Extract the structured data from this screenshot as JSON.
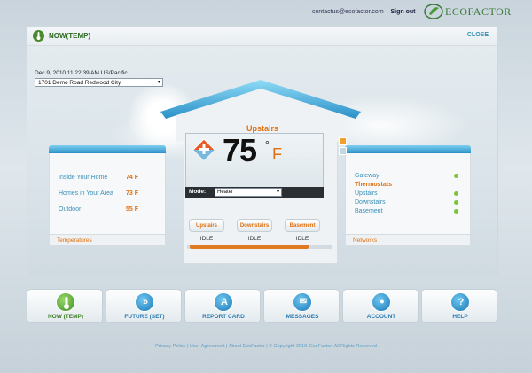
{
  "header": {
    "email": "contactus@ecofactor.com",
    "separator": "|",
    "signout": "Sign out",
    "logo_text": "ECOFACTOR"
  },
  "panel": {
    "title": "NOW(TEMP)",
    "close": "CLOSE",
    "datetime": "Dec 9, 2010 11:22:39 AM US/Pacific",
    "location": "1701 Demo Road Redwood City"
  },
  "temperatures": {
    "rows": [
      {
        "label": "Inside Your Home",
        "value": "74 F"
      },
      {
        "label": "Homes in Your Area",
        "value": "73 F"
      },
      {
        "label": "Outdoor",
        "value": "55 F"
      }
    ],
    "tab": "Temperatures"
  },
  "networks": {
    "rows": [
      {
        "label": "Gateway",
        "status": "ok"
      },
      {
        "label": "Thermostats",
        "status": "header"
      },
      {
        "label": "Upstairs",
        "status": "ok"
      },
      {
        "label": "Downstairs",
        "status": "ok"
      },
      {
        "label": "Basement",
        "status": "ok"
      }
    ],
    "tab": "Networks"
  },
  "thermostat": {
    "name": "Upstairs",
    "temp": "75",
    "degree": "°",
    "unit": "F",
    "mode_label": "Mode:",
    "mode_value": "Heater",
    "zones": [
      {
        "label": "Upstairs",
        "status": "IDLE"
      },
      {
        "label": "Downstairs",
        "status": "IDLE"
      },
      {
        "label": "Basement",
        "status": "IDLE"
      }
    ],
    "scroll_position": 0.85
  },
  "nav": [
    {
      "label": "NOW (TEMP)",
      "icon": "thermometer-icon",
      "glyph": "",
      "active": true
    },
    {
      "label": "FUTURE (SET)",
      "icon": "fast-forward-icon",
      "glyph": "»",
      "active": false
    },
    {
      "label": "REPORT CARD",
      "icon": "report-card-icon",
      "glyph": "A",
      "active": false
    },
    {
      "label": "MESSAGES",
      "icon": "envelope-icon",
      "glyph": "✉",
      "active": false
    },
    {
      "label": "ACCOUNT",
      "icon": "user-icon",
      "glyph": "●",
      "active": false
    },
    {
      "label": "HELP",
      "icon": "help-icon",
      "glyph": "?",
      "active": false
    }
  ],
  "footer": {
    "text": "Privacy Policy | User Agreement | About EcoFactor | © Copyright 2010. EcoFactor. All Rights Reserved"
  },
  "colors": {
    "accent_orange": "#e07010",
    "accent_blue": "#3a8fb7",
    "brand_green": "#3d7f25",
    "status_green": "#7cc43a"
  }
}
